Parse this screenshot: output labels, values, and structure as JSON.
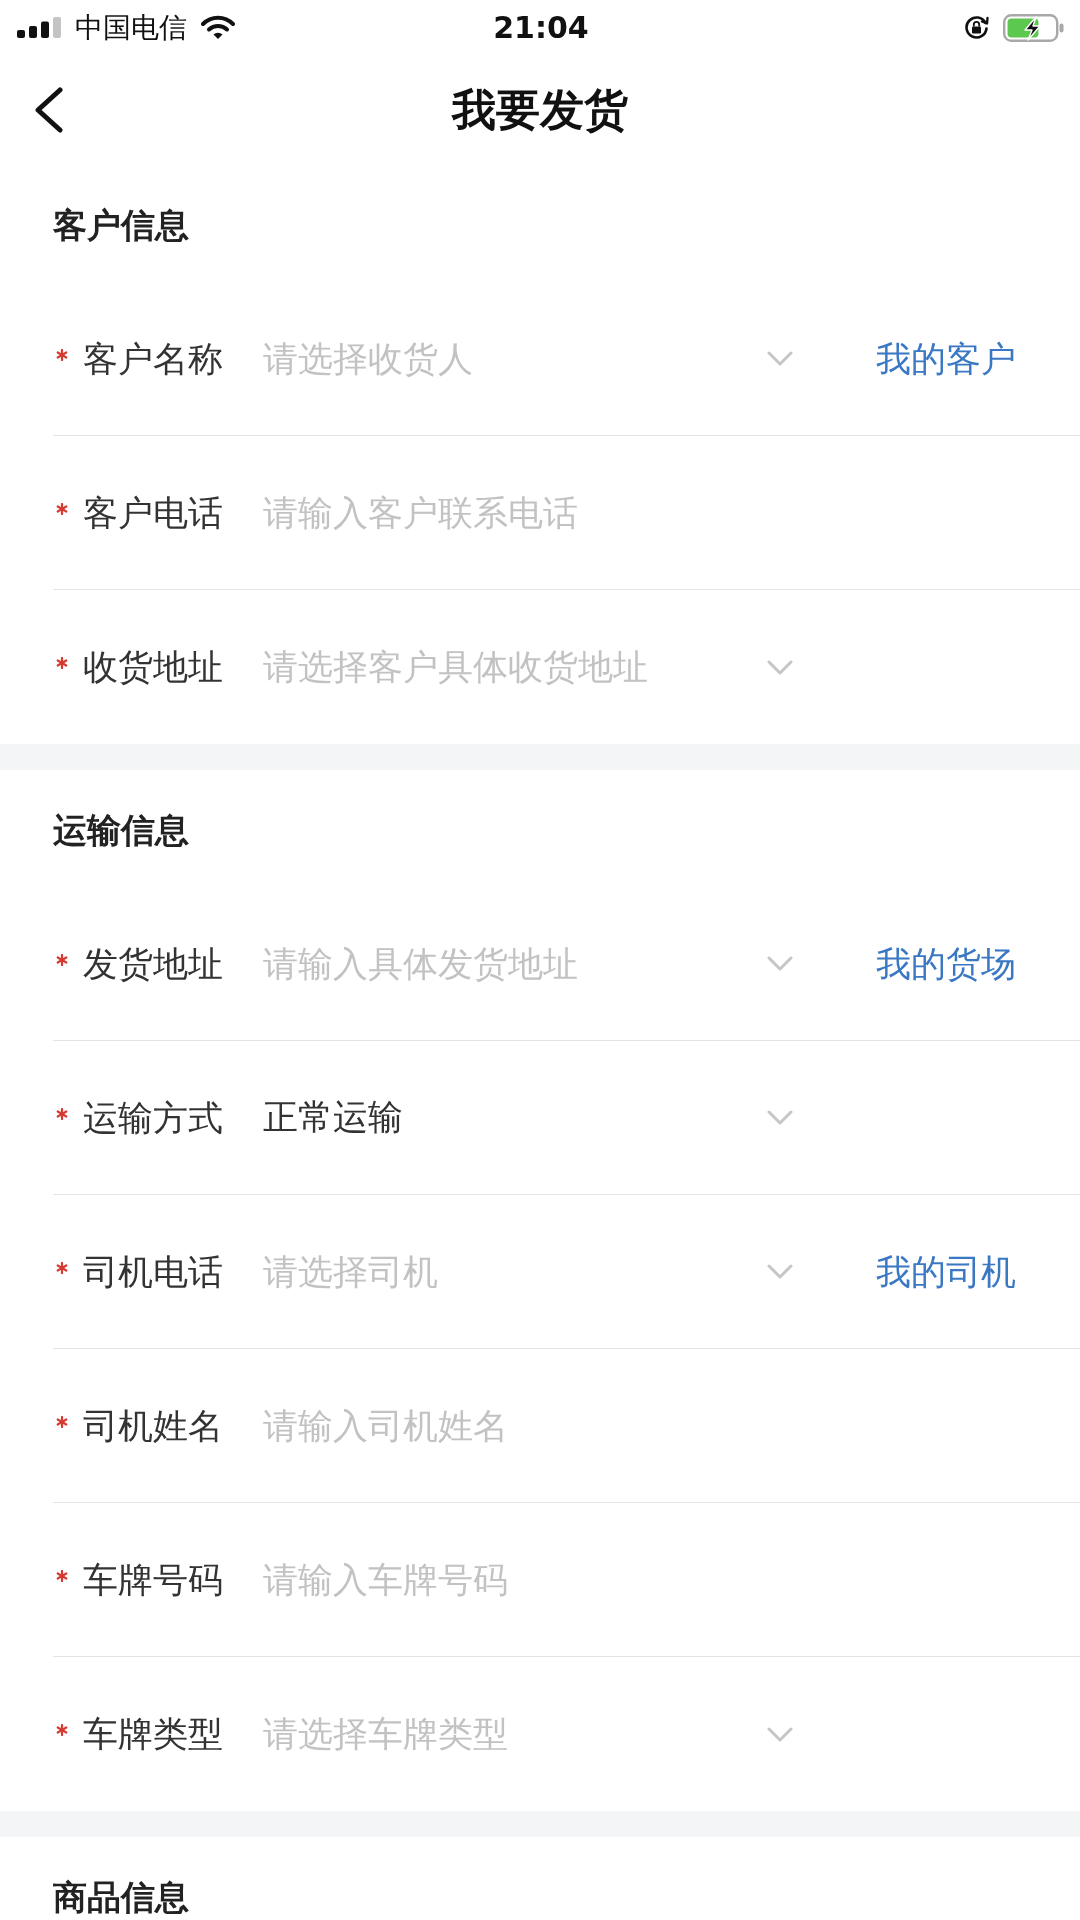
{
  "status_bar": {
    "carrier": "中国电信",
    "time": "21:04"
  },
  "nav_bar": {
    "title": "我要发货"
  },
  "sections": [
    {
      "title": "客户信息",
      "fields": [
        {
          "kind": "select",
          "required": true,
          "label": "客户名称",
          "placeholder": "请选择收货人",
          "link": "我的客户"
        },
        {
          "kind": "input",
          "required": true,
          "label": "客户电话",
          "placeholder": "请输入客户联系电话"
        },
        {
          "kind": "select",
          "required": true,
          "label": "收货地址",
          "placeholder": "请选择客户具体收货地址"
        }
      ]
    },
    {
      "title": "运输信息",
      "fields": [
        {
          "kind": "select",
          "required": true,
          "label": "发货地址",
          "placeholder": "请输入具体发货地址",
          "link": "我的货场"
        },
        {
          "kind": "select",
          "required": true,
          "label": "运输方式",
          "value": "正常运输"
        },
        {
          "kind": "select",
          "required": true,
          "label": "司机电话",
          "placeholder": "请选择司机",
          "link": "我的司机"
        },
        {
          "kind": "input",
          "required": true,
          "label": "司机姓名",
          "placeholder": "请输入司机姓名"
        },
        {
          "kind": "input",
          "required": true,
          "label": "车牌号码",
          "placeholder": "请输入车牌号码"
        },
        {
          "kind": "select",
          "required": true,
          "label": "车牌类型",
          "placeholder": "请选择车牌类型"
        }
      ]
    },
    {
      "title": "商品信息"
    }
  ]
}
